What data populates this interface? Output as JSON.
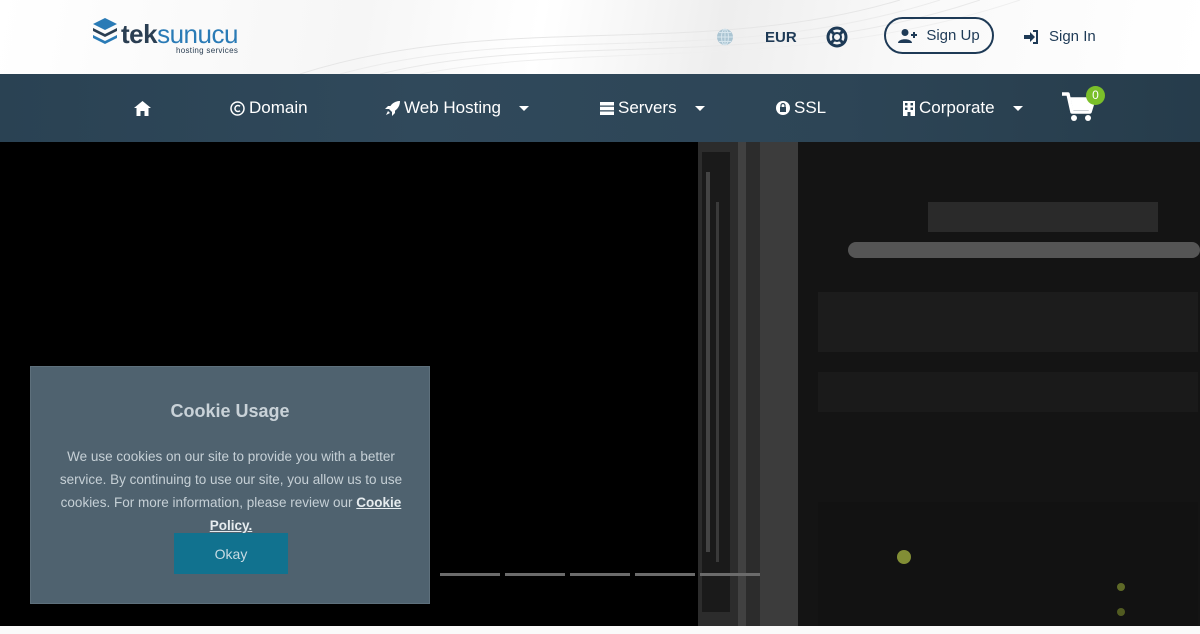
{
  "header": {
    "logo": {
      "brand_bold": "tek",
      "brand_light": "sunucu",
      "tagline": "hosting services"
    },
    "currency": "EUR",
    "signup_label": "Sign Up",
    "signin_label": "Sign In",
    "icons": [
      "globe-icon",
      "lifebuoy-icon",
      "user-plus-icon",
      "sign-in-icon"
    ]
  },
  "nav": {
    "items": [
      {
        "label": "",
        "icon": "home-icon"
      },
      {
        "label": "Domain",
        "icon": "copyright-icon"
      },
      {
        "label": "Web Hosting",
        "icon": "rocket-icon",
        "dropdown": true
      },
      {
        "label": "Servers",
        "icon": "server-icon",
        "dropdown": true
      },
      {
        "label": "SSL",
        "icon": "lock-icon"
      },
      {
        "label": "Corporate",
        "icon": "building-icon",
        "dropdown": true
      }
    ],
    "cart_count": "0"
  },
  "hero": {
    "slide_count": 5
  },
  "cookie": {
    "title": "Cookie Usage",
    "text": "We use cookies on our site to provide you with a better service. By continuing to use our site, you allow us to use cookies. For more information, please review our ",
    "link_label": "Cookie Policy.",
    "button_label": "Okay"
  },
  "colors": {
    "brand_dark": "#1e3a56",
    "brand_blue": "#2a7bb6",
    "nav_bg": "#2d4556",
    "cart_badge": "#7bbf2a",
    "cookie_bg": "#4f626f",
    "okay_button": "#11728f"
  }
}
